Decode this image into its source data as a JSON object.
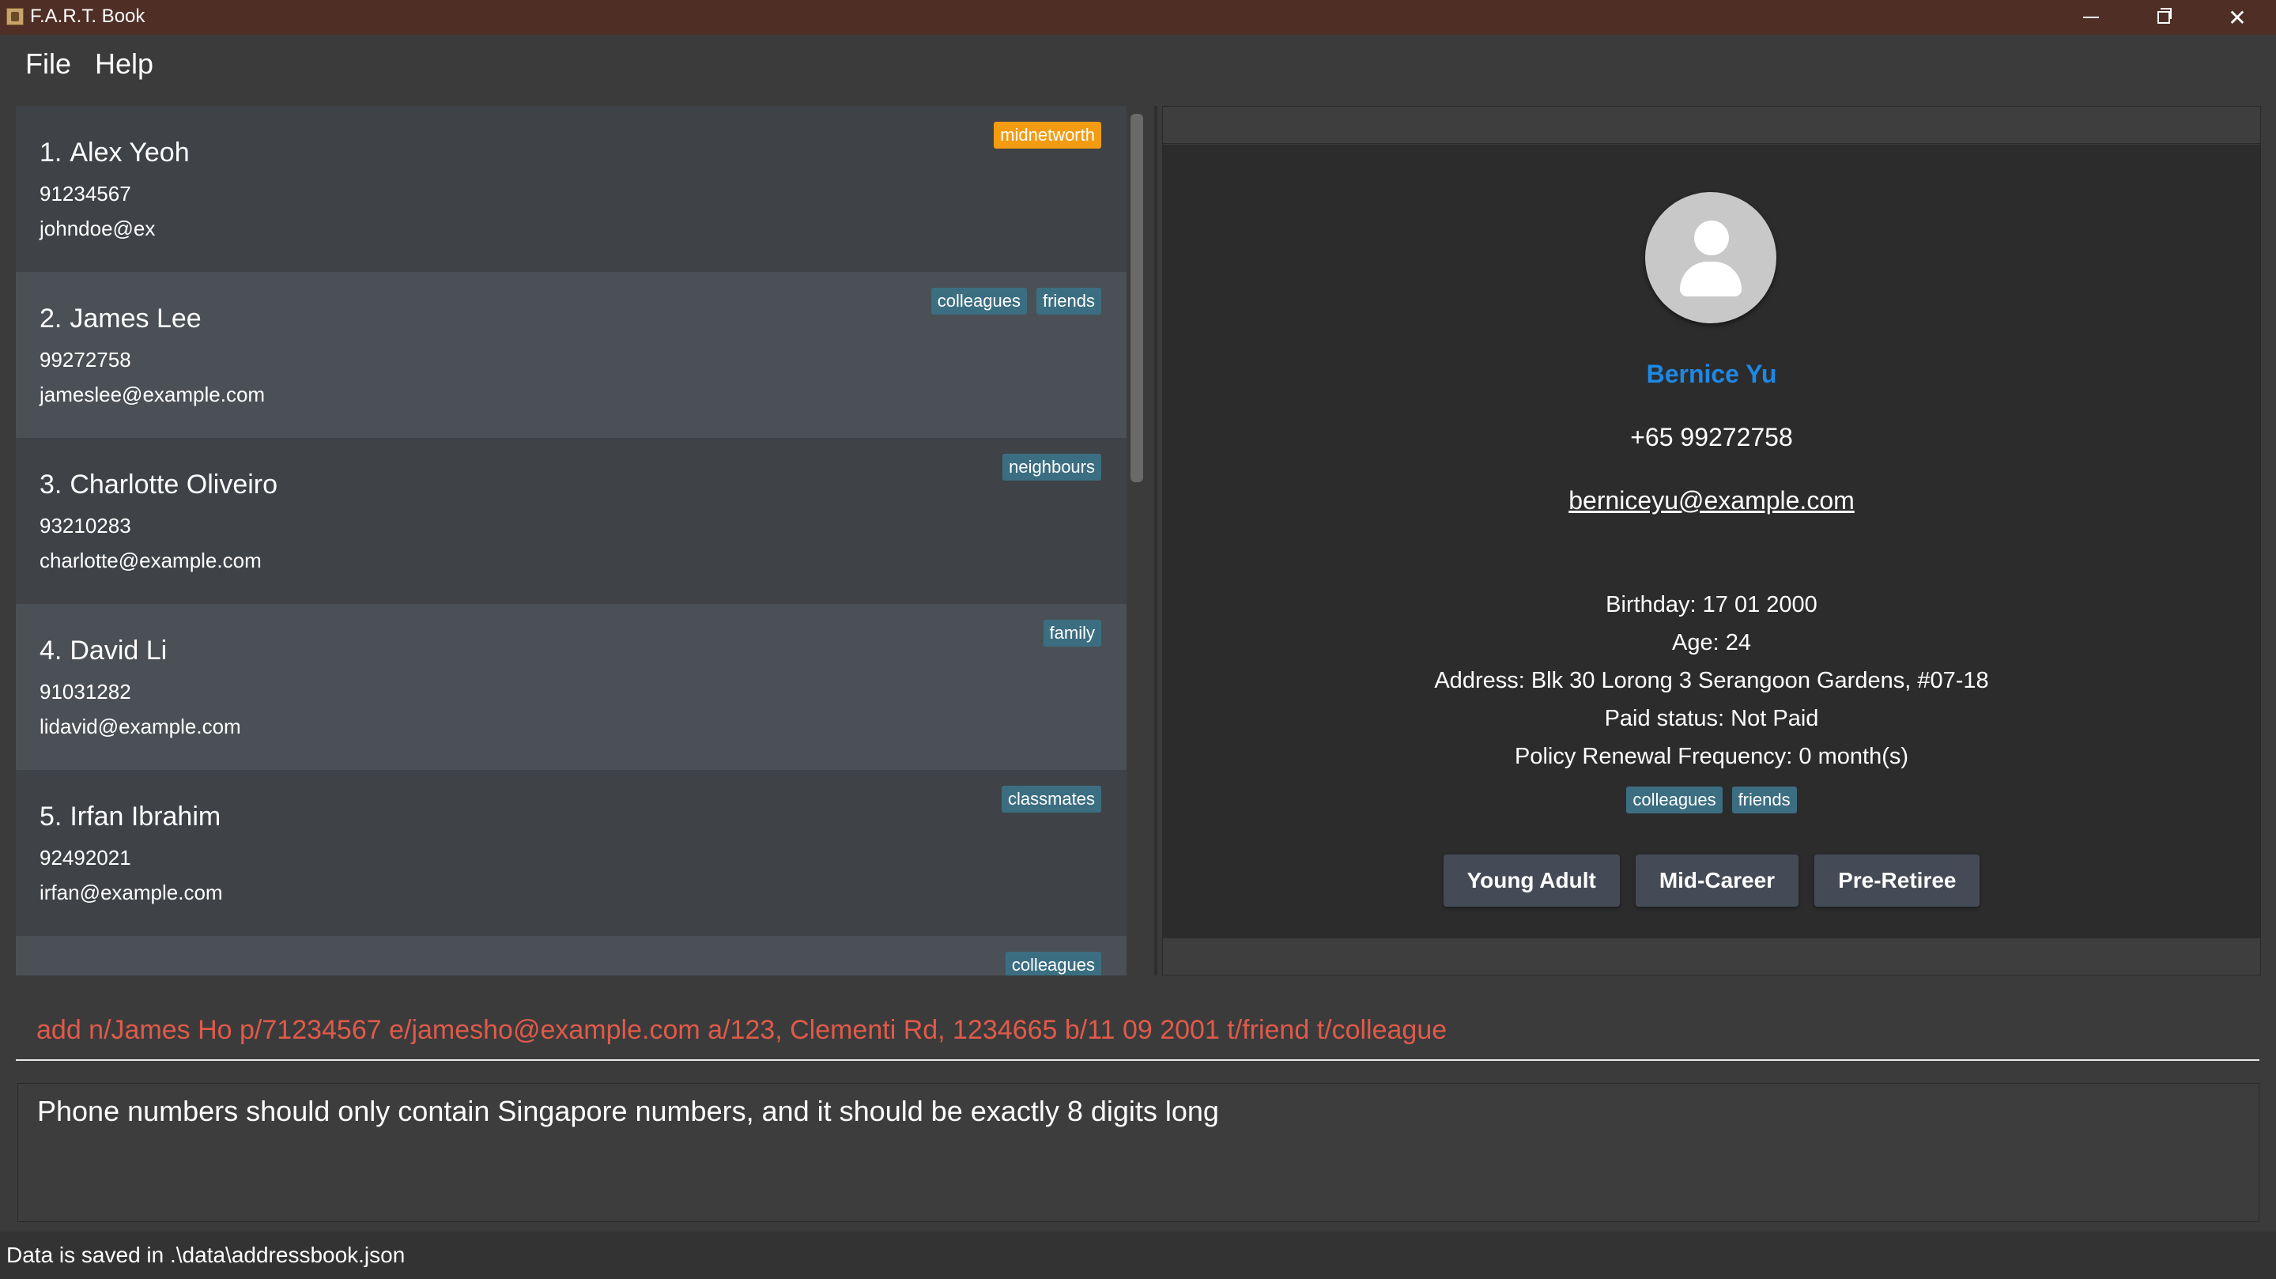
{
  "window": {
    "title": "F.A.R.T. Book"
  },
  "menu": {
    "items": [
      "File",
      "Help"
    ]
  },
  "persons": [
    {
      "index": "1.",
      "name": "Alex Yeoh",
      "phone": "91234567",
      "email": "johndoe@ex",
      "tags": [
        {
          "label": "midnetworth",
          "color": "#f39c12"
        }
      ]
    },
    {
      "index": "2.",
      "name": "James Lee",
      "phone": "99272758",
      "email": "jameslee@example.com",
      "tags": [
        {
          "label": "colleagues",
          "color": "#3c6e82"
        },
        {
          "label": "friends",
          "color": "#3c6e82"
        }
      ]
    },
    {
      "index": "3.",
      "name": "Charlotte Oliveiro",
      "phone": "93210283",
      "email": "charlotte@example.com",
      "tags": [
        {
          "label": "neighbours",
          "color": "#3c6e82"
        }
      ]
    },
    {
      "index": "4.",
      "name": "David Li",
      "phone": "91031282",
      "email": "lidavid@example.com",
      "tags": [
        {
          "label": "family",
          "color": "#3c6e82"
        }
      ]
    },
    {
      "index": "5.",
      "name": "Irfan Ibrahim",
      "phone": "92492021",
      "email": "irfan@example.com",
      "tags": [
        {
          "label": "classmates",
          "color": "#3c6e82"
        }
      ]
    },
    {
      "index": "",
      "name": "",
      "phone": "",
      "email": "",
      "tags": [
        {
          "label": "colleagues",
          "color": "#3c6e82"
        }
      ]
    }
  ],
  "detail": {
    "name": "Bernice Yu",
    "phone": "+65 99272758",
    "email": "berniceyu@example.com",
    "birthday": "Birthday: 17 01 2000",
    "age": "Age: 24",
    "address": "Address: Blk 30 Lorong 3 Serangoon Gardens, #07-18",
    "paid_status": "Paid status: Not Paid",
    "renewal": "Policy Renewal Frequency: 0 month(s)",
    "tags": [
      "colleagues",
      "friends"
    ],
    "buttons": [
      "Young Adult",
      "Mid-Career",
      "Pre-Retiree"
    ]
  },
  "command": {
    "value": "add n/James Ho p/71234567 e/jamesho@example.com a/123, Clementi Rd, 1234665 b/11 09 2001 t/friend t/colleague",
    "color": "#e05a4a"
  },
  "result": {
    "message": "Phone numbers should only contain Singapore numbers, and it should be exactly 8 digits long"
  },
  "status": {
    "text": "Data is saved in .\\data\\addressbook.json"
  },
  "colors": {
    "titlebar": "#4f2e26",
    "background": "#3b3b3b",
    "detail_name": "#1e88e5",
    "tag": "#3c6e82",
    "tag_highlight": "#f39c12"
  }
}
